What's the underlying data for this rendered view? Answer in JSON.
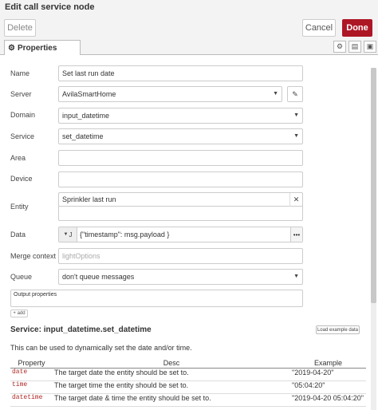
{
  "window": {
    "title": "Edit call service node"
  },
  "toolbar": {
    "delete_label": "Delete",
    "cancel_label": "Cancel",
    "done_label": "Done"
  },
  "tabs": {
    "properties_label": "Properties"
  },
  "form": {
    "name": {
      "label": "Name",
      "value": "Set last run date"
    },
    "server": {
      "label": "Server",
      "value": "AvilaSmartHome"
    },
    "domain": {
      "label": "Domain",
      "value": "input_datetime"
    },
    "service": {
      "label": "Service",
      "value": "set_datetime"
    },
    "area": {
      "label": "Area",
      "value": ""
    },
    "device": {
      "label": "Device",
      "value": ""
    },
    "entity": {
      "label": "Entity",
      "selected": "Sprinkler last run"
    },
    "data": {
      "label": "Data",
      "type_glyph": "J",
      "value": "{\"timestamp\": msg.payload }"
    },
    "merge_context": {
      "label": "Merge context",
      "placeholder": "lightOptions"
    },
    "queue": {
      "label": "Queue",
      "value": "don't queue messages"
    }
  },
  "output": {
    "label": "Output properties",
    "add_label": "+ add"
  },
  "service_info": {
    "title": "Service: input_datetime.set_datetime",
    "load_label": "Load example data",
    "description": "This can be used to dynamically set the date and/or time.",
    "headers": [
      "Property",
      "Desc",
      "Example"
    ],
    "rows": [
      {
        "property": "date",
        "desc": "The target date the entity should be set to.",
        "example": "\"2019-04-20\""
      },
      {
        "property": "time",
        "desc": "The target time the entity should be set to.",
        "example": "\"05:04:20\""
      },
      {
        "property": "datetime",
        "desc": "The target date & time the entity should be set to.",
        "example": "\"2019-04-20 05:04:20\""
      }
    ]
  },
  "colors": {
    "done": "#ad1625",
    "property_code": "#b02828"
  }
}
